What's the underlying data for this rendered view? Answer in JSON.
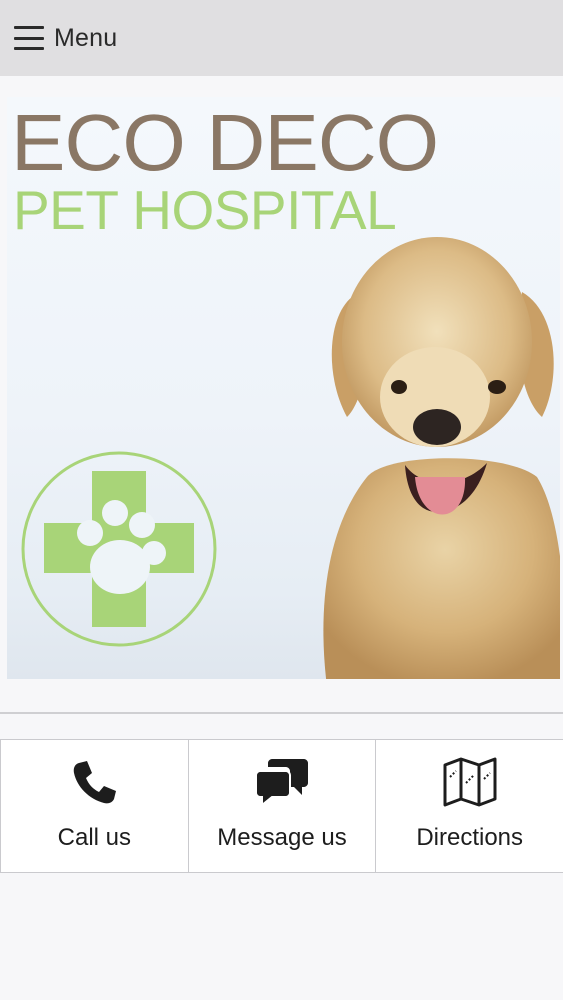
{
  "header": {
    "menu_label": "Menu"
  },
  "hero": {
    "title": "ECO DECO",
    "subtitle": "PET HOSPITAL"
  },
  "actions": [
    {
      "label": "Call us",
      "icon": "phone-icon"
    },
    {
      "label": "Message us",
      "icon": "chat-bubbles-icon"
    },
    {
      "label": "Directions",
      "icon": "map-icon"
    }
  ],
  "colors": {
    "title": "#8a7765",
    "subtitle": "#a8d478",
    "logo_green": "#a8d478",
    "topbar": "#e0dfe1"
  }
}
